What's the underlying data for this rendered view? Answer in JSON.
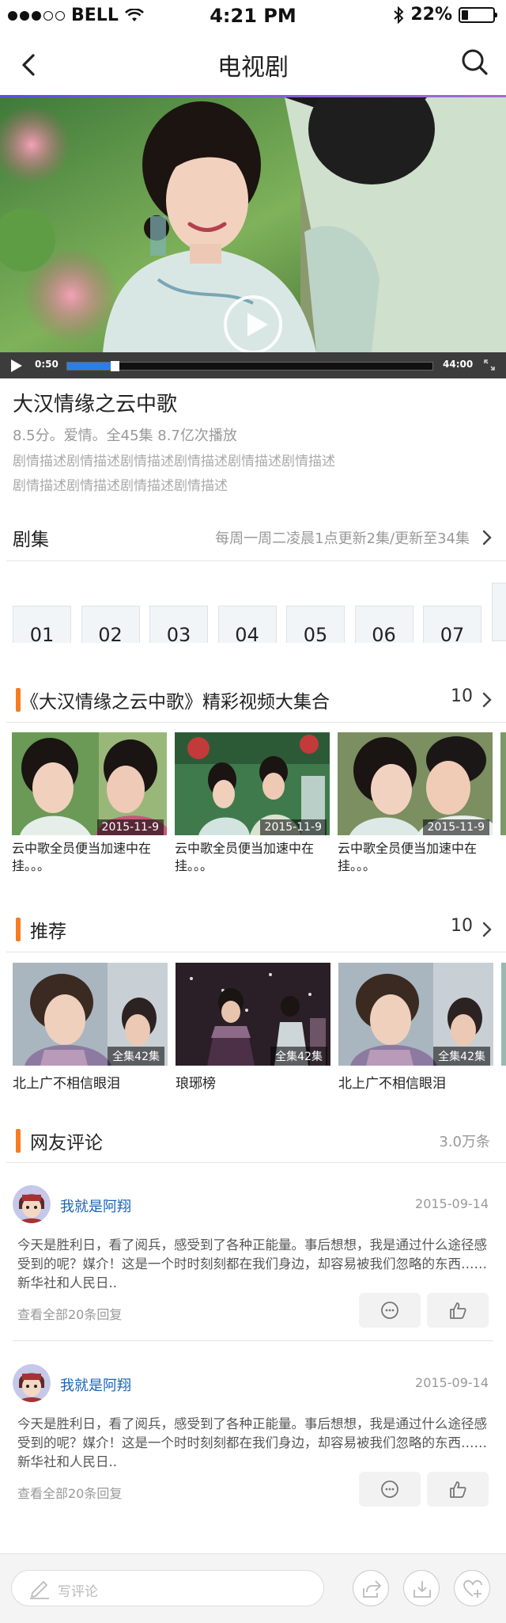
{
  "status_bar": {
    "carrier": "BELL",
    "time": "4:21 PM",
    "battery": "22%",
    "battery_level": 0.22
  },
  "nav": {
    "title": "电视剧"
  },
  "player": {
    "current_time": "0:50",
    "total_time": "44:00",
    "progress": 0.12
  },
  "show": {
    "title": "大汉情缘之云中歌",
    "meta": "8.5分。爱情。全45集  8.7亿次播放",
    "description_lines": [
      "剧情描述剧情描述剧情描述剧情描述剧情描述剧情描述",
      "剧情描述剧情描述剧情描述剧情描述"
    ]
  },
  "episodes": {
    "title": "剧集",
    "update_info": "每周一周二凌晨1点更新2集/更新至34集",
    "items": [
      "01",
      "02",
      "03",
      "04",
      "05",
      "06",
      "07"
    ]
  },
  "clips": {
    "title": "《大汉情缘之云中歌》精彩视频大集合",
    "count": "10",
    "items": [
      {
        "date": "2015-11-9",
        "caption": "云中歌全员便当加速中在挂。。。"
      },
      {
        "date": "2015-11-9",
        "caption": "云中歌全员便当加速中在挂。。。"
      },
      {
        "date": "2015-11-9",
        "caption": "云中歌全员便当加速中在挂。。。"
      }
    ]
  },
  "recommend": {
    "title": "推荐",
    "count": "10",
    "items": [
      {
        "badge": "全集42集",
        "caption": "北上广不相信眼泪"
      },
      {
        "badge": "全集42集",
        "caption": "琅琊榜"
      },
      {
        "badge": "全集42集",
        "caption": "北上广不相信眼泪"
      }
    ]
  },
  "comments": {
    "title": "网友评论",
    "count": "3.0万条",
    "items": [
      {
        "user": "我就是阿翔",
        "date": "2015-09-14",
        "text": "今天是胜利日，看了阅兵，感受到了各种正能量。事后想想，我是通过什么途径感受到的呢？媒介！这是一个时时刻刻都在我们身边，却容易被我们忽略的东西……新华社和人民日..",
        "replies": "查看全部20条回复"
      },
      {
        "user": "我就是阿翔",
        "date": "2015-09-14",
        "text": "今天是胜利日，看了阅兵，感受到了各种正能量。事后想想，我是通过什么途径感受到的呢？媒介！这是一个时时刻刻都在我们身边，却容易被我们忽略的东西……新华社和人民日..",
        "replies": "查看全部20条回复"
      }
    ]
  },
  "bottom_bar": {
    "placeholder": "写评论"
  },
  "colors": {
    "accent": "#f57c1f",
    "link": "#1b63b6",
    "progress": "#2d7ee3"
  }
}
